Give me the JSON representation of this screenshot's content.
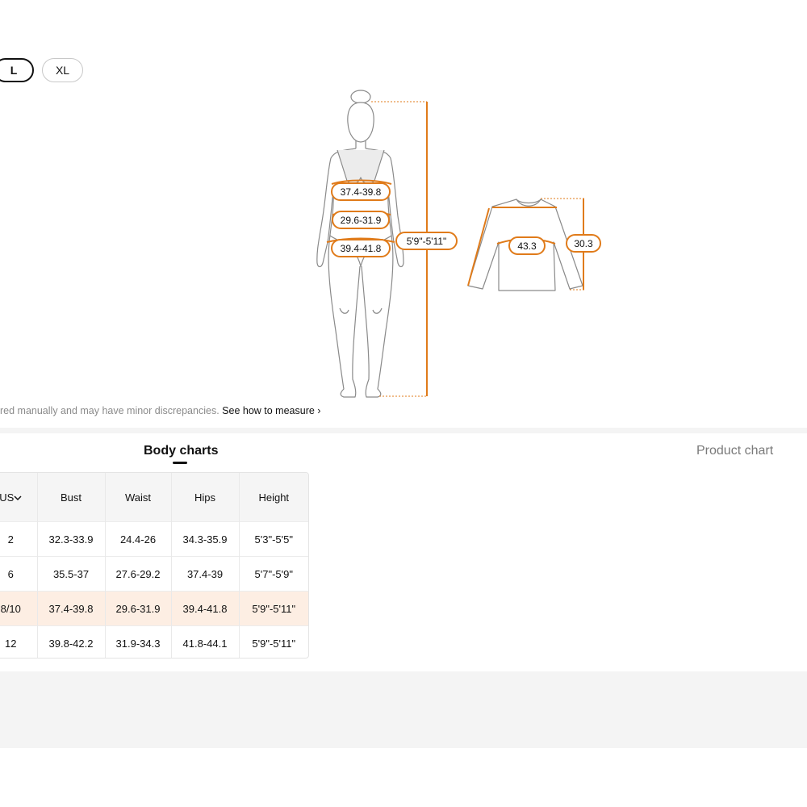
{
  "sizes": {
    "large": "L",
    "xlarge": "XL"
  },
  "figure": {
    "body_labels": {
      "bust": "37.4-39.8",
      "waist": "29.6-31.9",
      "hips": "39.4-41.8",
      "height": "5'9\"-5'11\""
    },
    "garment_labels": {
      "chest": "43.3",
      "length": "30.3"
    }
  },
  "note": {
    "text": "red manually and may have minor discrepancies.",
    "link": "See how to measure"
  },
  "tabs": {
    "body": "Body charts",
    "product": "Product chart"
  },
  "table": {
    "headers": [
      "US",
      "Bust",
      "Waist",
      "Hips",
      "Height"
    ],
    "rows": [
      [
        "2",
        "32.3-33.9",
        "24.4-26",
        "34.3-35.9",
        "5'3\"-5'5\""
      ],
      [
        "6",
        "35.5-37",
        "27.6-29.2",
        "37.4-39",
        "5'7\"-5'9\""
      ],
      [
        "8/10",
        "37.4-39.8",
        "29.6-31.9",
        "39.4-41.8",
        "5'9\"-5'11\""
      ],
      [
        "12",
        "39.8-42.2",
        "31.9-34.3",
        "41.8-44.1",
        "5'9\"-5'11\""
      ]
    ]
  },
  "colors": {
    "accent": "#e07b1a",
    "highlight_row": "#fdeee3",
    "outline": "#8a8a8a"
  },
  "icons": {
    "unit_dropdown": "chevron-down-icon",
    "link_arrow": "chevron-right-icon"
  }
}
